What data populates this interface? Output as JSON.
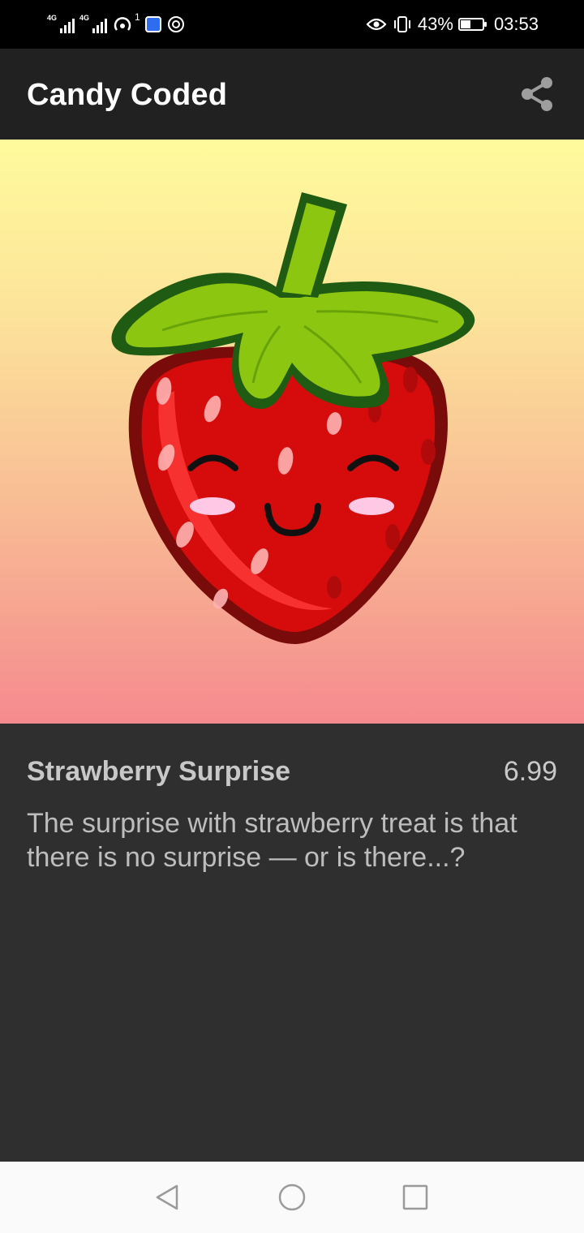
{
  "status_bar": {
    "network_1": "4G",
    "network_2": "4G",
    "notification_count": "1",
    "battery_percent": "43%",
    "time": "03:53"
  },
  "app_bar": {
    "title": "Candy Coded",
    "share_icon": "share-icon"
  },
  "hero": {
    "image_subject": "strawberry"
  },
  "product": {
    "name": "Strawberry Surprise",
    "price": "6.99",
    "description": "The surprise with strawberry treat is that there is no surprise — or is there...?"
  },
  "nav_bar": {
    "back_icon": "back-triangle-icon",
    "home_icon": "home-circle-icon",
    "recents_icon": "recents-square-icon"
  },
  "colors": {
    "status_bar_bg": "#000000",
    "app_bar_bg": "#212121",
    "details_bg": "#2f2f2f",
    "text_primary": "#ffffff",
    "text_secondary": "#c8c8c8",
    "nav_bar_bg": "#fafafa",
    "strawberry_red": "#d70f0f",
    "leaf_green": "#8cc610"
  }
}
